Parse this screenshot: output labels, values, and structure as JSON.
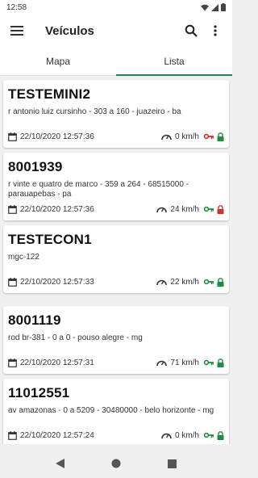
{
  "status_bar": {
    "time": "12:58"
  },
  "app_bar": {
    "title": "Veículos",
    "icons": [
      "menu-icon",
      "search-icon",
      "more-vert-icon"
    ]
  },
  "tabs": [
    {
      "label": "Mapa",
      "active": false
    },
    {
      "label": "Lista",
      "active": true
    }
  ],
  "colors": {
    "accent": "#2e7d5b",
    "lock_green": "#1e8e3e",
    "lock_red": "#d32f2f",
    "key_red": "#d32f2f",
    "key_green": "#1e8e3e"
  },
  "vehicles": [
    {
      "name": "TESTEMINI2",
      "address": "r antonio luiz cursinho - 303 a 160 - juazeiro - ba",
      "datetime": "22/10/2020 12:57:36",
      "speed": "0 km/h",
      "ignition": "off",
      "lock": "locked-green"
    },
    {
      "name": "8001939",
      "address": "r vinte e quatro de marco - 359 a 264 - 68515000 - parauapebas - pa",
      "datetime": "22/10/2020 12:57:36",
      "speed": "24 km/h",
      "ignition": "on",
      "lock": "locked-red"
    },
    {
      "name": "TESTECON1",
      "address": "mgc-122",
      "datetime": "22/10/2020 12:57:33",
      "speed": "22 km/h",
      "ignition": "on",
      "lock": "locked-green"
    },
    {
      "name": "8001119",
      "address": "rod br-381 - 0 a 0 - pouso alegre - mg",
      "datetime": "22/10/2020 12:57:31",
      "speed": "71 km/h",
      "ignition": "on",
      "lock": "locked-green"
    },
    {
      "name": "11012551",
      "address": "av amazonas - 0 a 5209 - 30480000 - belo horizonte - mg",
      "datetime": "22/10/2020 12:57:24",
      "speed": "0 km/h",
      "ignition": "on",
      "lock": "locked-green"
    }
  ],
  "nav_bar": [
    "back-icon",
    "home-icon",
    "recents-icon"
  ]
}
